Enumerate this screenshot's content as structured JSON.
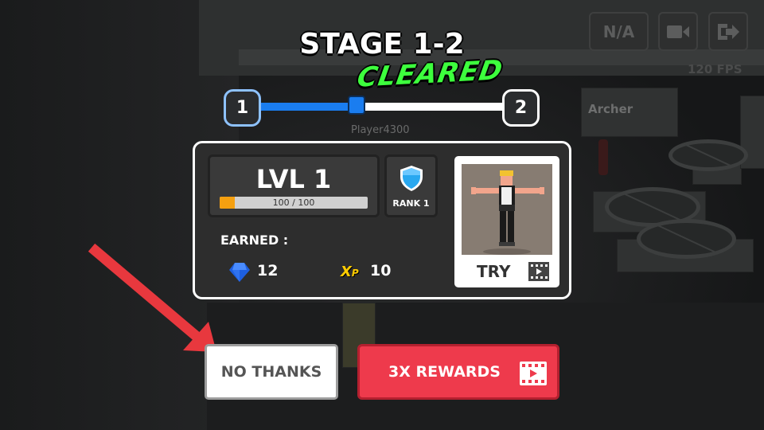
{
  "hud": {
    "na_label": "N/A",
    "fps_label": "120 FPS",
    "camera_icon": "video-camera-icon",
    "exit_icon": "exit-icon"
  },
  "world": {
    "enemy_name": "Archer",
    "player_name": "Player4300"
  },
  "stage": {
    "title": "STAGE 1-2",
    "status": "CLEARED",
    "current_node": "1",
    "next_node": "2",
    "progress": 0.4
  },
  "results": {
    "level_label": "LVL 1",
    "xp_text": "100 / 100",
    "xp_fraction": 0.1,
    "rank_label": "RANK 1",
    "earned_label": "EARNED :",
    "gems": "12",
    "xp_icon_main": "X",
    "xp_icon_sub": "P",
    "xp_earned": "10",
    "try_label": "TRY"
  },
  "buttons": {
    "no_thanks": "NO THANKS",
    "rewards": "3X REWARDS"
  },
  "colors": {
    "accent_blue": "#1a7df0",
    "cleared_green": "#3dff3d",
    "reward_red": "#ee3a4c",
    "xp_orange": "#f5a010",
    "arrow_red": "#e8383e"
  }
}
